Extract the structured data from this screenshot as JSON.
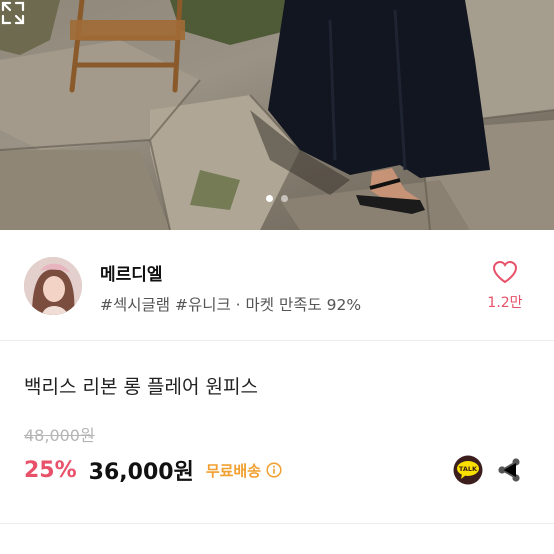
{
  "hero": {
    "image": "product-photo",
    "page_indicator": {
      "total": 2,
      "active": 1
    },
    "expand_icon": "fullscreen-icon"
  },
  "seller": {
    "name": "메르디엘",
    "tags": "#섹시글램 #유니크 · 마켓 만족도 92%",
    "like_icon": "heart-outline-icon",
    "like_count": "1.2만"
  },
  "product": {
    "title": "백리스 리본 롱 플레어 원피스",
    "original_price": "48,000원",
    "discount": "25%",
    "price": "36,000원",
    "shipping": "무료배송",
    "shipping_info_icon": "info-icon",
    "talk_label": "TALK",
    "share_icon": "share-icon"
  },
  "colors": {
    "accent": "#e8516a",
    "shipping": "#f0a030",
    "talk_bg": "#3c1e1e"
  }
}
